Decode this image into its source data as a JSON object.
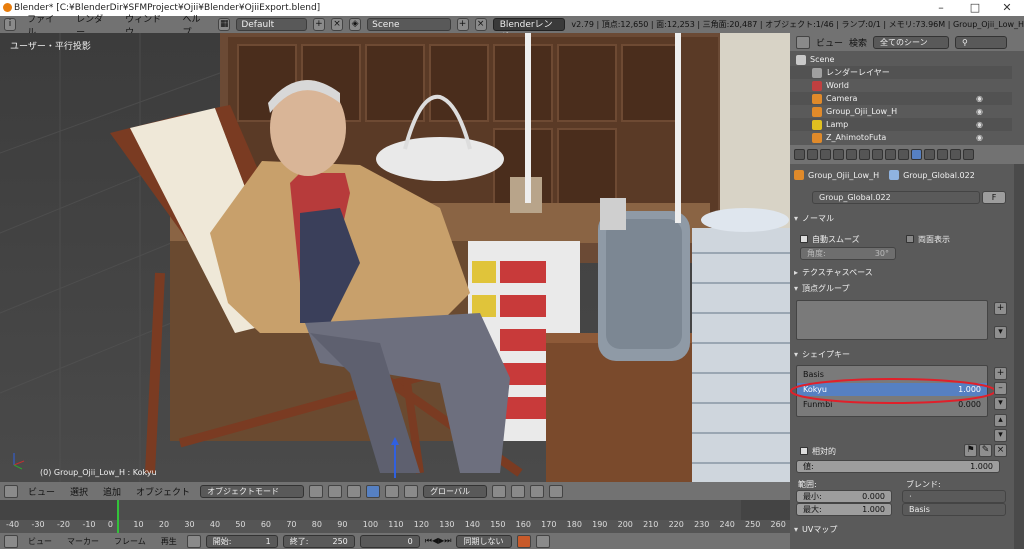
{
  "window": {
    "title": "Blender* [C:¥BlenderDir¥SFMProject¥Ojii¥Blender¥OjiiExport.blend]"
  },
  "info_header": {
    "menus": [
      "ファイル",
      "レンダー",
      "ウィンドウ",
      "ヘルプ"
    ],
    "layout": "Default",
    "scene": "Scene",
    "engine": "Blenderレンダー",
    "stats": "v2.79 | 頂点:12,650 | 面:12,253 | 三角面:20,487 | オブジェクト:1/46 | ランプ:0/1 | メモリ:73.96M | Group_Ojii_Low_H"
  },
  "viewport": {
    "view_label": "ユーザー・平行投影",
    "object_label": "(0) Group_Ojii_Low_H : Kokyu"
  },
  "view3d_header": {
    "menus": [
      "ビュー",
      "選択",
      "追加",
      "オブジェクト"
    ],
    "mode": "オブジェクトモード",
    "orientation": "グローバル"
  },
  "timeline": {
    "ticks": [
      "-40",
      "-30",
      "-20",
      "-10",
      "0",
      "10",
      "20",
      "30",
      "40",
      "50",
      "60",
      "70",
      "80",
      "90",
      "100",
      "110",
      "120",
      "130",
      "140",
      "150",
      "160",
      "170",
      "180",
      "190",
      "200",
      "210",
      "220",
      "230",
      "240",
      "250",
      "260"
    ],
    "current_frame": 0
  },
  "bottom_header": {
    "menus": [
      "ビュー",
      "マーカー",
      "フレーム",
      "再生"
    ],
    "start_label": "開始:",
    "start_value": "1",
    "end_label": "終了:",
    "end_value": "250",
    "frame_value": "0",
    "sync": "同期しない"
  },
  "outliner": {
    "header": {
      "view": "ビュー",
      "search": "検索",
      "filter": "全てのシーン"
    },
    "items": [
      {
        "label": "Scene",
        "icon_color": "#c9c9c9"
      },
      {
        "label": "レンダーレイヤー",
        "icon_color": "#a0a0a0"
      },
      {
        "label": "World",
        "icon_color": "#c04040"
      },
      {
        "label": "Camera",
        "icon_color": "#e08a2a"
      },
      {
        "label": "Group_Ojii_Low_H",
        "icon_color": "#e08a2a"
      },
      {
        "label": "Lamp",
        "icon_color": "#e0c020"
      },
      {
        "label": "Z_AhimotoFuta",
        "icon_color": "#e08a2a"
      }
    ]
  },
  "properties": {
    "breadcrumb": {
      "object": "Group_Ojii_Low_H",
      "data": "Group_Global.022"
    },
    "mesh_name": "Group_Global.022",
    "fake_user": "F",
    "normals": {
      "title": "ノーマル",
      "auto_smooth": "自動スムーズ",
      "double_sided": "両面表示",
      "angle": "角度:",
      "angle_value": "30°"
    },
    "texture_space": "テクスチャスペース",
    "vertex_groups": "頂点グループ",
    "shape_keys": {
      "title": "シェイプキー",
      "keys": [
        {
          "name": "Basis",
          "value": ""
        },
        {
          "name": "Kokyu",
          "value": "1.000"
        },
        {
          "name": "Funmbi",
          "value": "0.000"
        }
      ],
      "relative": "相対的",
      "value_label": "値:",
      "value": "1.000",
      "range_label": "範囲:",
      "min_label": "最小:",
      "min_value": "0.000",
      "max_label": "最大:",
      "max_value": "1.000",
      "blend_label": "ブレンド:",
      "blend_target": "Basis"
    },
    "uv_maps": "UVマップ",
    "highlight_color": "#e0202a"
  }
}
